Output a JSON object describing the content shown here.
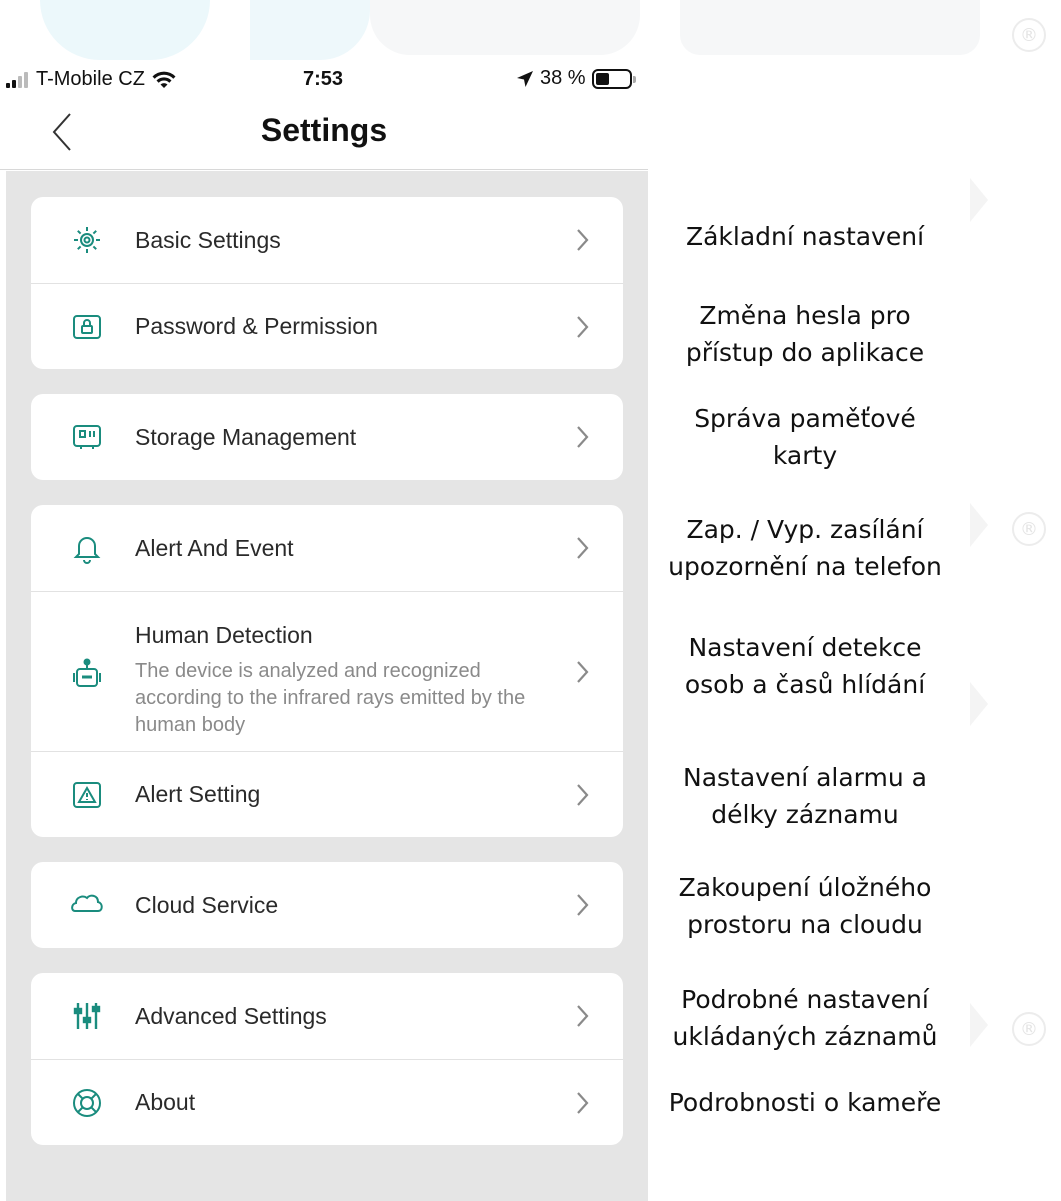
{
  "status_bar": {
    "carrier": "T-Mobile CZ",
    "time": "7:53",
    "battery_percent": "38 %",
    "signal_icon": "signal-bars-icon",
    "wifi_icon": "wifi-icon",
    "location_icon": "location-arrow-icon",
    "battery_icon": "battery-icon"
  },
  "nav": {
    "title": "Settings",
    "back_icon": "chevron-left-icon"
  },
  "cards": [
    {
      "items": [
        {
          "label": "Basic Settings",
          "icon": "gear-sun-icon"
        },
        {
          "label": "Password & Permission",
          "icon": "lock-icon"
        }
      ]
    },
    {
      "items": [
        {
          "label": "Storage Management",
          "icon": "sd-card-icon"
        }
      ]
    },
    {
      "items": [
        {
          "label": "Alert And Event",
          "icon": "bell-icon"
        },
        {
          "label": "Human Detection",
          "sub": "The device is analyzed and recognized according to the infrared rays emitted by the human body",
          "icon": "robot-icon"
        },
        {
          "label": "Alert Setting",
          "icon": "warning-icon"
        }
      ]
    },
    {
      "items": [
        {
          "label": "Cloud Service",
          "icon": "cloud-icon"
        }
      ]
    },
    {
      "items": [
        {
          "label": "Advanced Settings",
          "icon": "sliders-icon"
        },
        {
          "label": "About",
          "icon": "lifebuoy-icon"
        }
      ]
    }
  ],
  "captions": [
    {
      "lines": [
        "Základní nastavení"
      ]
    },
    {
      "lines": [
        "Změna hesla pro",
        "přístup do aplikace"
      ]
    },
    {
      "lines": [
        "Správa paměťové",
        "karty"
      ]
    },
    {
      "lines": [
        "Zap. / Vyp. zasílání",
        "upozornění na telefon"
      ]
    },
    {
      "lines": [
        "Nastavení detekce",
        "osob a časů hlídání"
      ]
    },
    {
      "lines": [
        "Nastavení alarmu a",
        "délky záznamu"
      ]
    },
    {
      "lines": [
        "Zakoupení úložného",
        "prostoru na cloudu"
      ]
    },
    {
      "lines": [
        "Podrobné nastavení",
        "ukládaných záznamů"
      ]
    },
    {
      "lines": [
        "Podrobnosti o kameře"
      ]
    }
  ],
  "watermark": {
    "mark": "®"
  },
  "colors": {
    "accent": "#1a8c7e",
    "background": "#e5e5e5",
    "card": "#ffffff"
  }
}
